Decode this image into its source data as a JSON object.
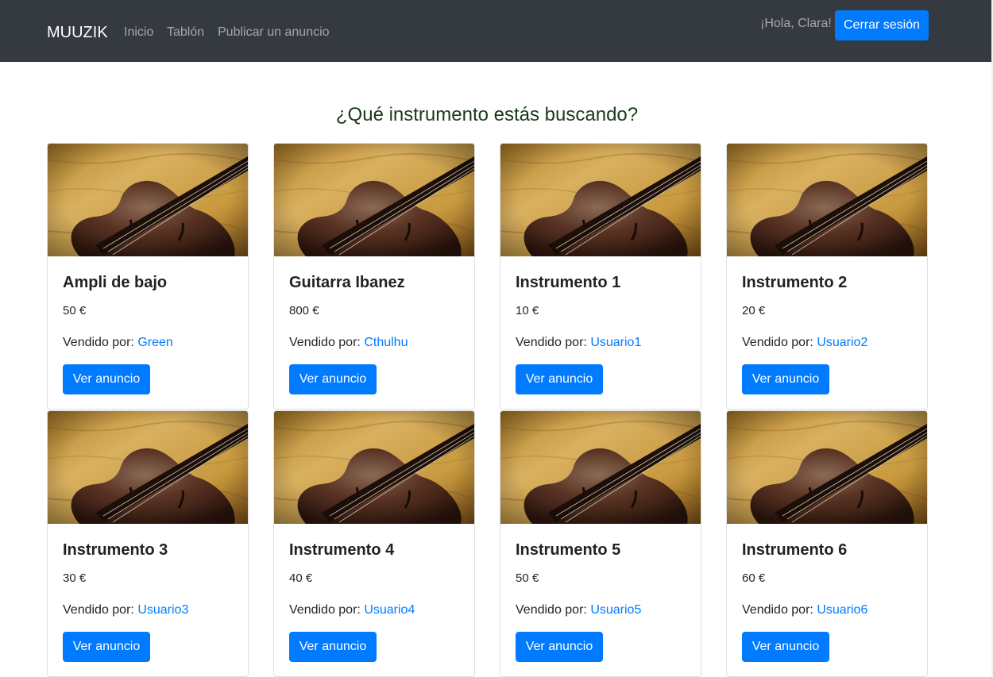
{
  "navbar": {
    "brand": "MUUZIK",
    "links": [
      "Inicio",
      "Tablón",
      "Publicar un anuncio"
    ],
    "greeting": "¡Hola, Clara!",
    "logout": "Cerrar sesión",
    "background": "#343a40"
  },
  "main": {
    "heading": "¿Qué instrumento estás buscando?",
    "sold_by_label": "Vendido por:",
    "button_label": "Ver anuncio",
    "accent": "#007bff",
    "image": "violin-photo",
    "listings": [
      {
        "title": "Ampli de bajo",
        "price": "50 €",
        "seller": "Green"
      },
      {
        "title": "Guitarra Ibanez",
        "price": "800 €",
        "seller": "Cthulhu"
      },
      {
        "title": "Instrumento 1",
        "price": "10 €",
        "seller": "Usuario1"
      },
      {
        "title": "Instrumento 2",
        "price": "20 €",
        "seller": "Usuario2"
      },
      {
        "title": "Instrumento 3",
        "price": "30 €",
        "seller": "Usuario3"
      },
      {
        "title": "Instrumento 4",
        "price": "40 €",
        "seller": "Usuario4"
      },
      {
        "title": "Instrumento 5",
        "price": "50 €",
        "seller": "Usuario5"
      },
      {
        "title": "Instrumento 6",
        "price": "60 €",
        "seller": "Usuario6"
      }
    ]
  }
}
